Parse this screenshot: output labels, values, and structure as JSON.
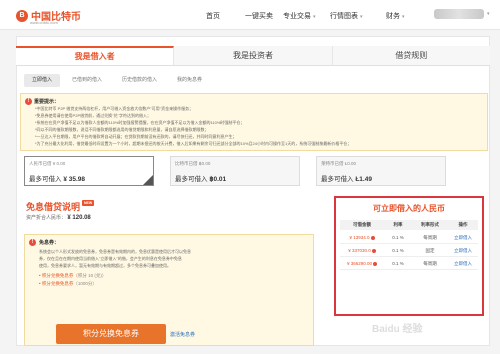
{
  "brand": {
    "name": "中国比特币",
    "mark": "B",
    "sub": "www.chbtc.com"
  },
  "nav": {
    "items": [
      {
        "label": "首页",
        "chevron": false
      },
      {
        "label": "一键买卖",
        "chevron": false
      },
      {
        "label": "专业交易",
        "chevron": true
      },
      {
        "label": "行情图表",
        "chevron": true
      },
      {
        "label": "财务",
        "chevron": true
      }
    ]
  },
  "main_tabs": [
    "我是借入者",
    "我是投资者",
    "借贷规则"
  ],
  "sub_tabs": [
    "立即借入",
    "已借到的借入",
    "历史借款的借入",
    "我的免息券"
  ],
  "notice": {
    "icon": "!",
    "title": "重要提示：",
    "lines": [
      "*中国比特币 P2P 借贷支持两倍杠杆，用户可借入资金放大倍数户\"可用\"资金来操作服务；",
      "*免息券使用请在使用P2P借贷前，通过兑换\"兑\"字符达到的借入；",
      "*系统在在资产净值不足以为借款人金额的110%时加强报警提醒，在在资产净值不足以为借入金额的110%时强制平仓；",
      "*同以不同的借款期限数，说话不同借款期限都选用的借贷期限和利息量，请自愿选择借款期限数；",
      "*一旦达入平台期限，用户平台的借款将自动开展；在贷款到期前没有还款的，请尽快归还，并同时同意利息产生；",
      "*为了充分最大化利用，借贷最低时间设置为一个小时，超期未偿还的按天计费，借入后如果有剩余可归还部分全部的10%且24小时内可操作至1天的，系统可强制按最新价格平仓；"
    ]
  },
  "stats": [
    {
      "label": "人民币已借",
      "amount": "¥ 0.00",
      "value_label": "最多可借入",
      "value": "¥ 35.98"
    },
    {
      "label": "比特币已借",
      "amount": "฿0.00",
      "value_label": "最多可借入",
      "value": "฿0.01"
    },
    {
      "label": "莱特币已借",
      "amount": "Ł0.00",
      "value_label": "最多可借入",
      "value": "Ł1.49"
    }
  ],
  "free": {
    "title": "免息借贷说明",
    "badge": "NEW",
    "asset_label": "资产折合人民币：",
    "asset_value": "¥ 120.08"
  },
  "usage": {
    "icon": "!",
    "title": "免息券：",
    "lines": [
      "系统会以个人形式发放的免息券，免息券是有效期内的，免息优惠是使用后才可以免息",
      "券，仅在且在在期内使用当前借入\"立即借入\"的借，会产生的利息在免息券中免息",
      "使用，免息券要求人，暂无有效期与有效期超过，多个免息券可叠加使用。"
    ],
    "bullets": [
      {
        "text": "• 积分兑换免息券（",
        "sub": "积分 10 (兑)）"
      },
      {
        "text": "• 积分兑换免息券",
        "sub": "（1000分）"
      }
    ],
    "exchange_button": "积分兑换免息券",
    "cancel_link": "激活免息券"
  },
  "available": {
    "title": "可立即借入的人民币",
    "columns": [
      "可借金额",
      "利率",
      "利率形式",
      "操作"
    ],
    "rows": [
      {
        "amount": "¥ 13934.0",
        "rate": "0.1 %",
        "type": "每周期",
        "action": "立即借入"
      },
      {
        "amount": "¥ 337030.0",
        "rate": "0.1 %",
        "type": "固定",
        "action": "立即借入"
      },
      {
        "amount": "¥ 366290.00",
        "rate": "0.1 %",
        "type": "每周期",
        "action": "立即借入"
      }
    ]
  },
  "watermark": "Baidu 经验"
}
